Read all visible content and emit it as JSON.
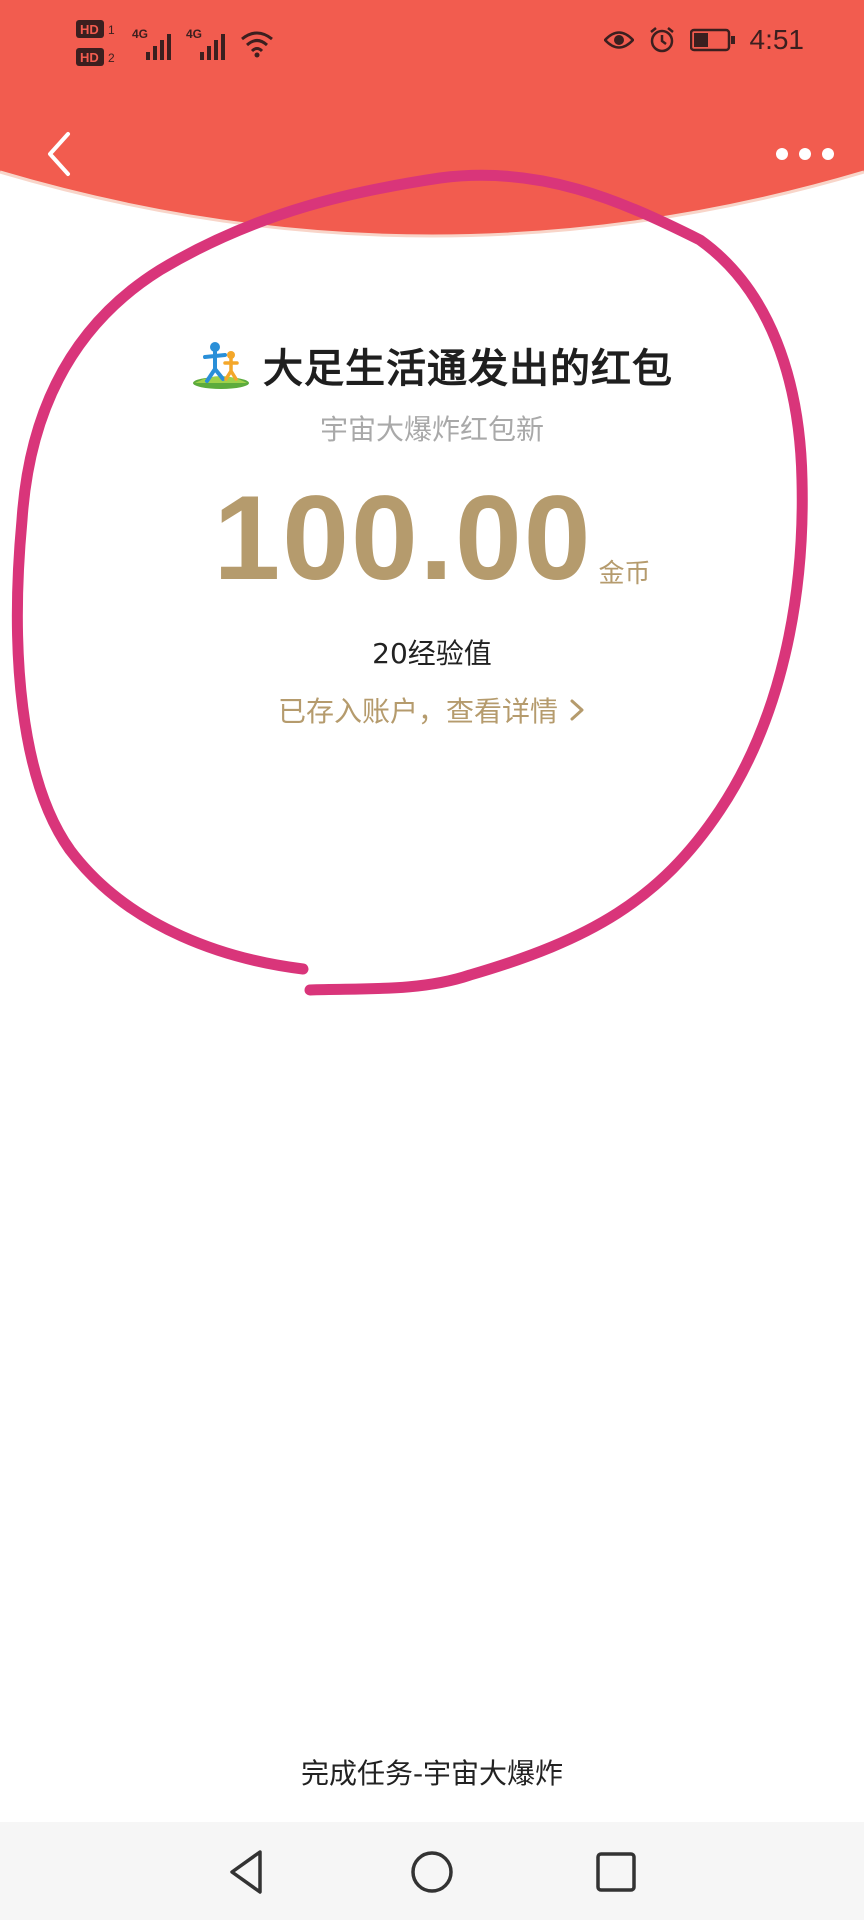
{
  "status_bar": {
    "sim1": "HD",
    "sim2": "HD",
    "net1": "4G",
    "net2": "4G",
    "time": "4:51",
    "icons": [
      "hd-icon",
      "signal-icon",
      "wifi-icon",
      "eye-icon",
      "alarm-icon",
      "battery-icon"
    ]
  },
  "colors": {
    "header_red": "#f25c4f",
    "gold": "#b59b6d",
    "annotation_pink": "#d9357a"
  },
  "nav": {
    "back_icon": "chevron-left-icon",
    "more_icon": "more-dots-icon"
  },
  "red_packet": {
    "sender": "大足生活通发出的红包",
    "greeting": "宇宙大爆炸红包新",
    "amount": "100.00",
    "unit": "金币",
    "experience": "20经验值",
    "detail_link": "已存入账户，查看详情"
  },
  "footer": {
    "task_text": "完成任务-宇宙大爆炸"
  },
  "system_nav": {
    "back": "triangle-back-icon",
    "home": "circle-home-icon",
    "recent": "square-recent-icon"
  }
}
